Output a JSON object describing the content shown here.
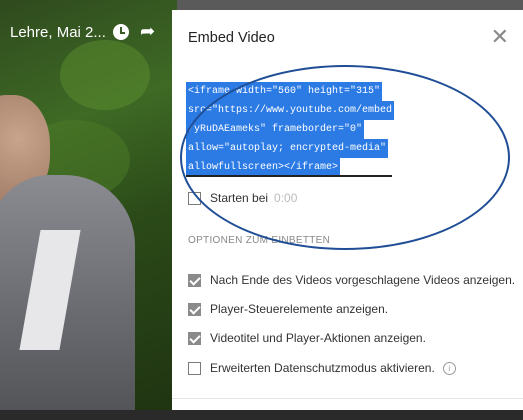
{
  "video": {
    "title": "Lehre, Mai 2...",
    "watch_later_icon": "clock-icon",
    "share_icon": "share-icon"
  },
  "dialog": {
    "title": "Embed Video",
    "close_icon": "close-icon",
    "embed_code_lines": [
      "<iframe width=\"560\" height=\"315\"",
      "src=\"https://www.youtube.com/embed",
      "/yRuDAEameks\" frameborder=\"0\"",
      "allow=\"autoplay; encrypted-media\"",
      "allowfullscreen></iframe>"
    ],
    "start_at": {
      "label": "Starten bei",
      "value": "0:00",
      "checked": false
    },
    "options_heading": "OPTIONEN ZUM EINBETTEN",
    "options": [
      {
        "label": "Nach Ende des Videos vorgeschlagene Videos anzeigen.",
        "checked": true
      },
      {
        "label": "Player-Steuerelemente anzeigen.",
        "checked": true
      },
      {
        "label": "Videotitel und Player-Aktionen anzeigen.",
        "checked": true
      },
      {
        "label": "Erweiterten Datenschutzmodus aktivieren.",
        "checked": false
      }
    ],
    "info_icon": "info-icon"
  },
  "colors": {
    "selection": "#2c7be5",
    "annotation_ellipse": "#1f4e96"
  }
}
